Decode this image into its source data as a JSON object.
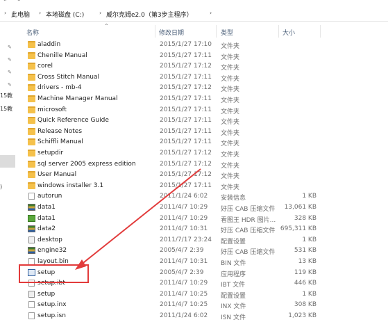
{
  "breadcrumb": {
    "items": [
      "此电脑",
      "本地磁盘 (C:)",
      "威尔克姆e2.0（第3步主程序）"
    ]
  },
  "columns": {
    "name": "名称",
    "date": "修改日期",
    "type": "类型",
    "size": "大小"
  },
  "left_pane": {
    "texts": [
      "15教",
      "15教",
      ")"
    ]
  },
  "files": [
    {
      "name": "aladdin",
      "date": "2015/1/27 17:10",
      "type": "文件夹",
      "size": "",
      "icon": "folder-icon"
    },
    {
      "name": "Chenille Manual",
      "date": "2015/1/27 17:11",
      "type": "文件夹",
      "size": "",
      "icon": "folder-icon"
    },
    {
      "name": "corel",
      "date": "2015/1/27 17:12",
      "type": "文件夹",
      "size": "",
      "icon": "folder-icon"
    },
    {
      "name": "Cross Stitch Manual",
      "date": "2015/1/27 17:11",
      "type": "文件夹",
      "size": "",
      "icon": "folder-icon"
    },
    {
      "name": "drivers - mb-4",
      "date": "2015/1/27 17:12",
      "type": "文件夹",
      "size": "",
      "icon": "folder-icon"
    },
    {
      "name": "Machine Manager Manual",
      "date": "2015/1/27 17:11",
      "type": "文件夹",
      "size": "",
      "icon": "folder-icon"
    },
    {
      "name": "microsoft",
      "date": "2015/1/27 17:11",
      "type": "文件夹",
      "size": "",
      "icon": "folder-icon"
    },
    {
      "name": "Quick Reference Guide",
      "date": "2015/1/27 17:11",
      "type": "文件夹",
      "size": "",
      "icon": "folder-icon"
    },
    {
      "name": "Release Notes",
      "date": "2015/1/27 17:11",
      "type": "文件夹",
      "size": "",
      "icon": "folder-icon"
    },
    {
      "name": "Schiffli Manual",
      "date": "2015/1/27 17:11",
      "type": "文件夹",
      "size": "",
      "icon": "folder-icon"
    },
    {
      "name": "setupdir",
      "date": "2015/1/27 17:12",
      "type": "文件夹",
      "size": "",
      "icon": "folder-icon"
    },
    {
      "name": "sql server 2005 express edition",
      "date": "2015/1/27 17:12",
      "type": "文件夹",
      "size": "",
      "icon": "folder-icon"
    },
    {
      "name": "User Manual",
      "date": "2015/1/27 17:12",
      "type": "文件夹",
      "size": "",
      "icon": "folder-icon"
    },
    {
      "name": "windows installer 3.1",
      "date": "2015/1/27 17:11",
      "type": "文件夹",
      "size": "",
      "icon": "folder-icon"
    },
    {
      "name": "autorun",
      "date": "2011/1/24 6:02",
      "type": "安装信息",
      "size": "1 KB",
      "icon": "file-icon"
    },
    {
      "name": "data1",
      "date": "2011/4/7 10:29",
      "type": "好压 CAB 压缩文件",
      "size": "13,061 KB",
      "icon": "cab-icon"
    },
    {
      "name": "data1",
      "date": "2011/4/7 10:29",
      "type": "看图王 HDR 图片...",
      "size": "328 KB",
      "icon": "hdr-icon"
    },
    {
      "name": "data2",
      "date": "2011/4/7 10:31",
      "type": "好压 CAB 压缩文件",
      "size": "695,311 KB",
      "icon": "cab-icon"
    },
    {
      "name": "desktop",
      "date": "2011/7/17 23:24",
      "type": "配置设置",
      "size": "1 KB",
      "icon": "config-icon"
    },
    {
      "name": "engine32",
      "date": "2005/4/7 2:39",
      "type": "好压 CAB 压缩文件",
      "size": "531 KB",
      "icon": "cab-icon"
    },
    {
      "name": "layout.bin",
      "date": "2011/4/7 10:31",
      "type": "BIN 文件",
      "size": "13 KB",
      "icon": "file-icon"
    },
    {
      "name": "setup",
      "date": "2005/4/7 2:39",
      "type": "应用程序",
      "size": "119 KB",
      "icon": "exe-icon"
    },
    {
      "name": "setup.ibt",
      "date": "2011/4/7 10:29",
      "type": "IBT 文件",
      "size": "446 KB",
      "icon": "file-icon"
    },
    {
      "name": "setup",
      "date": "2011/4/7 10:25",
      "type": "配置设置",
      "size": "1 KB",
      "icon": "config-icon"
    },
    {
      "name": "setup.inx",
      "date": "2011/4/7 10:25",
      "type": "INX 文件",
      "size": "308 KB",
      "icon": "file-icon"
    },
    {
      "name": "setup.isn",
      "date": "2011/1/24 6:02",
      "type": "ISN 文件",
      "size": "1,023 KB",
      "icon": "file-icon"
    }
  ],
  "annotation": {
    "color": "#e23b3b",
    "target": "setup"
  }
}
